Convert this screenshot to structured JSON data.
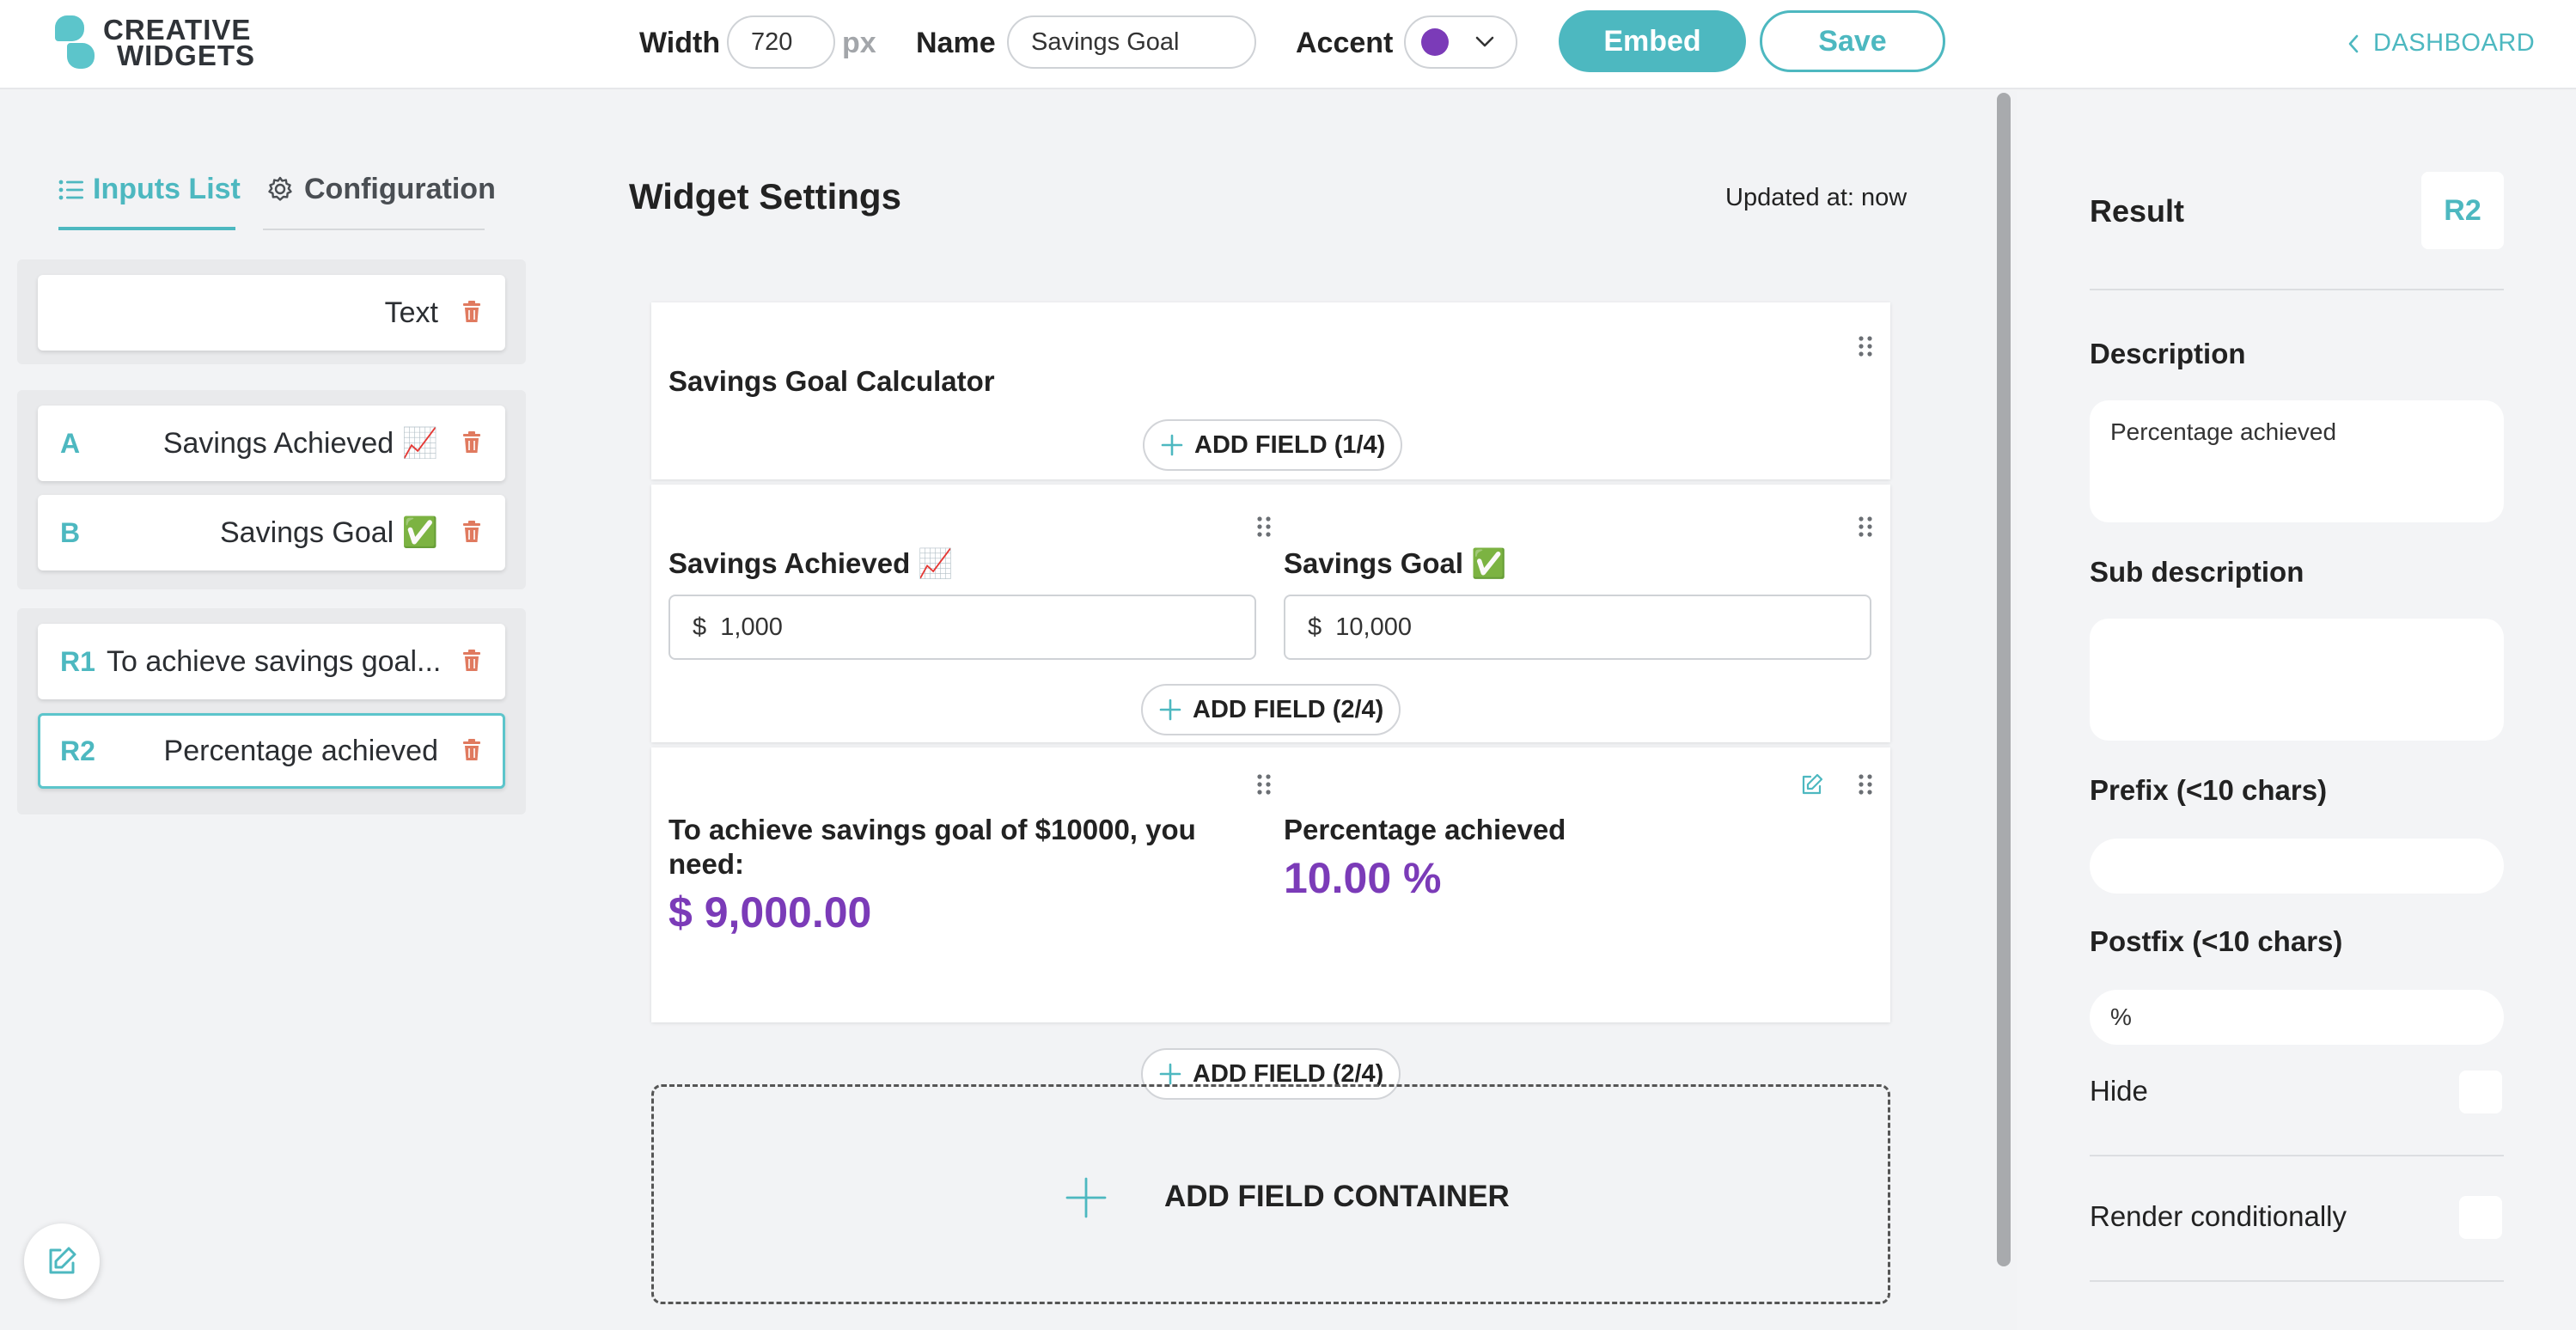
{
  "brand": {
    "line1": "CREATIVE",
    "line2": "WIDGETS"
  },
  "toolbar": {
    "width_label": "Width",
    "width_value": "720",
    "width_unit": "px",
    "name_label": "Name",
    "name_value": "Savings Goal",
    "accent_label": "Accent",
    "accent_color": "#7b3bb8",
    "embed_label": "Embed",
    "save_label": "Save",
    "dashboard_label": "DASHBOARD"
  },
  "sidebar": {
    "tabs": [
      {
        "label": "Inputs List",
        "icon": "list-icon",
        "active": true
      },
      {
        "label": "Configuration",
        "icon": "gear-icon",
        "active": false
      }
    ],
    "groups": [
      {
        "items": [
          {
            "badge": "",
            "label": "Text"
          }
        ]
      },
      {
        "items": [
          {
            "badge": "A",
            "label": "Savings Achieved 📈"
          },
          {
            "badge": "B",
            "label": "Savings Goal ✅"
          }
        ]
      },
      {
        "items": [
          {
            "badge": "R1",
            "label": "To achieve savings goal..."
          },
          {
            "badge": "R2",
            "label": "Percentage achieved",
            "selected": true
          }
        ]
      }
    ]
  },
  "main": {
    "title": "Widget Settings",
    "updated": "Updated at: now",
    "containers": [
      {
        "title": "Savings Goal Calculator",
        "add_field": "ADD FIELD (1/4)"
      },
      {
        "fields": [
          {
            "title": "Savings Achieved 📈",
            "prefix": "$",
            "value": "1,000"
          },
          {
            "title": "Savings Goal ✅",
            "prefix": "$",
            "value": "10,000"
          }
        ],
        "add_field": "ADD FIELD (2/4)"
      },
      {
        "results": [
          {
            "title": "To achieve savings goal of $10000, you need:",
            "value": "$ 9,000.00"
          },
          {
            "title": "Percentage achieved",
            "value": "10.00 %"
          }
        ],
        "add_field": "ADD FIELD (2/4)"
      }
    ],
    "add_container": "ADD FIELD CONTAINER"
  },
  "result_panel": {
    "title": "Result",
    "badge": "R2",
    "description_label": "Description",
    "description_value": "Percentage achieved",
    "sub_description_label": "Sub description",
    "sub_description_value": "",
    "prefix_label": "Prefix (<10 chars)",
    "prefix_value": "",
    "postfix_label": "Postfix (<10 chars)",
    "postfix_value": "%",
    "hide_label": "Hide",
    "render_conditionally_label": "Render conditionally"
  },
  "colors": {
    "accent": "#4db8c0",
    "result": "#7b3bb8",
    "trash": "#e07a5f"
  }
}
